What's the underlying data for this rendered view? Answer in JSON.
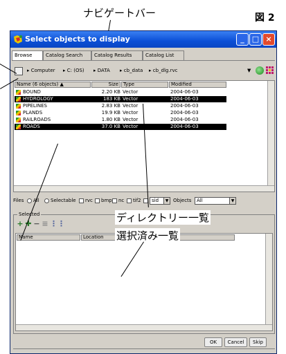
{
  "annotations": {
    "nav_bar": "ナビゲートバー",
    "figure": "図 2",
    "directory_list": "ディレクトリー一覧",
    "selected_list": "選択済み一覧"
  },
  "window": {
    "title": "Select objects to display"
  },
  "tabs": [
    "Browse",
    "Catalog Search",
    "Catalog Results",
    "Catalog List"
  ],
  "nav": {
    "crumbs": [
      "Computer",
      "C: (OS)",
      "DATA",
      "cb_data",
      "cb_dlg.rvc"
    ]
  },
  "file_list": {
    "headers": {
      "name": "Name (6 objects)",
      "size": "Size",
      "type": "Type",
      "modified": "Modified"
    },
    "rows": [
      {
        "name": "BOUND",
        "size": "2.20 KB",
        "type": "Vector",
        "modified": "2004-06-03",
        "selected": false
      },
      {
        "name": "HYDROLOGY",
        "size": "183 KB",
        "type": "Vector",
        "modified": "2004-06-03",
        "selected": true
      },
      {
        "name": "PIPELINES",
        "size": "2.83 KB",
        "type": "Vector",
        "modified": "2004-06-03",
        "selected": false
      },
      {
        "name": "PLANDS",
        "size": "19.9 KB",
        "type": "Vector",
        "modified": "2004-06-03",
        "selected": false
      },
      {
        "name": "RAILROADS",
        "size": "1.80 KB",
        "type": "Vector",
        "modified": "2004-06-03",
        "selected": false
      },
      {
        "name": "ROADS",
        "size": "37.0 KB",
        "type": "Vector",
        "modified": "2004-06-03",
        "selected": true
      }
    ]
  },
  "filters": {
    "files_label": "Files",
    "all": "All",
    "selectable": "Selectable",
    "rvc": "rvc",
    "bmp": "bmp",
    "nc": "nc",
    "tif2": "tif2",
    "sid_value": "sid",
    "objects_label": "Objects",
    "objects_value": "All"
  },
  "selected_panel": {
    "legend": "Selected",
    "col_name": "Name",
    "col_location": "Location"
  },
  "buttons": {
    "ok": "OK",
    "cancel": "Cancel",
    "skip": "Skip"
  }
}
